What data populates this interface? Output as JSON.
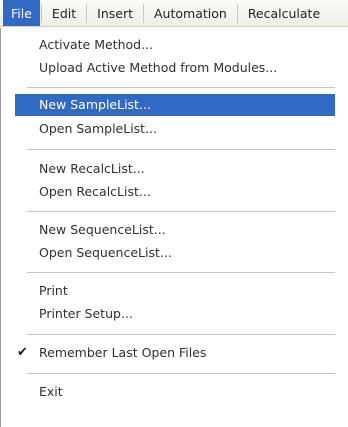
{
  "menubar": {
    "items": [
      "File",
      "Edit",
      "Insert",
      "Automation",
      "Recalculate"
    ]
  },
  "menu": {
    "activate_method": "Activate Method...",
    "upload_active_method": "Upload Active Method from Modules...",
    "new_samplelist": "New SampleList...",
    "open_samplelist": "Open SampleList...",
    "new_recalclist": "New RecalcList...",
    "open_recalclist": "Open RecalcList...",
    "new_sequencelist": "New SequenceList...",
    "open_sequencelist": "Open SequenceList...",
    "print": "Print",
    "printer_setup": "Printer Setup...",
    "remember_last_open_files": "Remember Last Open Files",
    "remember_checked_glyph": "✔",
    "exit": "Exit"
  },
  "colors": {
    "highlight": "#316ac5",
    "menubar_bg": "#f4f3ee",
    "text": "#303030"
  }
}
